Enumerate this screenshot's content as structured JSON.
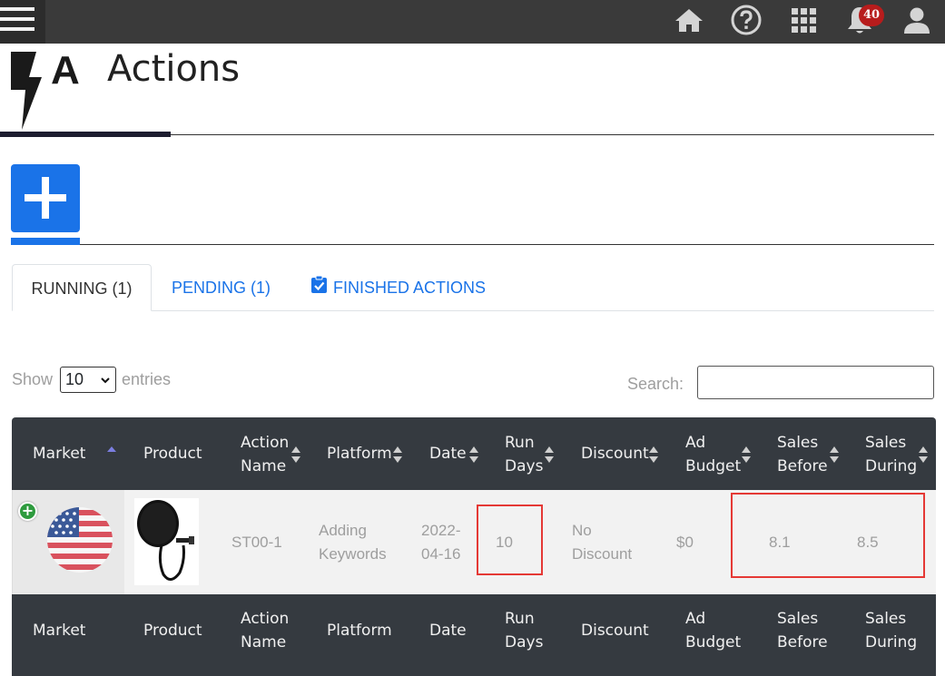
{
  "topbar": {
    "icons": [
      "menu-icon",
      "home-icon",
      "help-icon",
      "apps-grid-icon",
      "notification-bell-icon",
      "user-icon"
    ],
    "notification_count": "40",
    "background": "#3a3a3a"
  },
  "header": {
    "logo_letter": "A",
    "title": "Actions"
  },
  "tabs": [
    {
      "label": "RUNNING (1)",
      "active": true
    },
    {
      "label": "PENDING (1)",
      "active": false
    },
    {
      "label": "FINISHED ACTIONS",
      "active": false,
      "icon": "clipboard-check-icon"
    }
  ],
  "entries": {
    "show_label": "Show",
    "selected": "10",
    "entries_label": "entries"
  },
  "search": {
    "label": "Search:",
    "value": ""
  },
  "table": {
    "columns": [
      {
        "line1": "Market",
        "line2": ""
      },
      {
        "line1": "Product",
        "line2": ""
      },
      {
        "line1": "Action",
        "line2": "Name"
      },
      {
        "line1": "Platform",
        "line2": ""
      },
      {
        "line1": "Date",
        "line2": ""
      },
      {
        "line1": "Run",
        "line2": "Days"
      },
      {
        "line1": "Discount",
        "line2": ""
      },
      {
        "line1": "Ad",
        "line2": "Budget"
      },
      {
        "line1": "Sales",
        "line2": "Before"
      },
      {
        "line1": "Sales",
        "line2": "During"
      }
    ],
    "rows": [
      {
        "market": "us-flag-icon",
        "product": "pop-filter-microphone",
        "action_name": "ST00-1",
        "platform_l1": "Adding",
        "platform_l2": "Keywords",
        "date_l1": "2022-",
        "date_l2": "04-16",
        "run_days": "10",
        "discount_l1": "No",
        "discount_l2": "Discount",
        "ad_budget": "$0",
        "sales_before": "8.1",
        "sales_during": "8.5"
      }
    ]
  },
  "colors": {
    "accent": "#1a73e8",
    "table_header": "#353a40",
    "highlight": "#e53935",
    "badge": "#b71c1c"
  }
}
